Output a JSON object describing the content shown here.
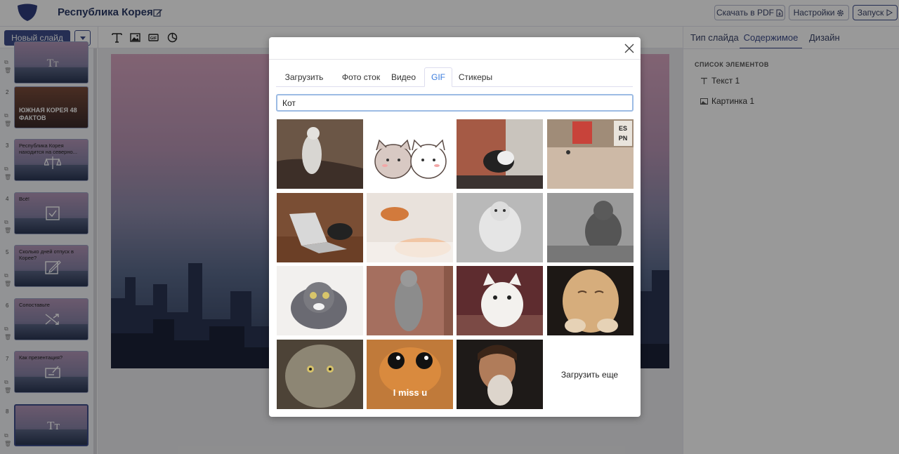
{
  "app": {
    "presentation_title": "Республика Корея",
    "download_label": "Скачать в PDF",
    "settings_label": "Настройки",
    "launch_label": "Запуск"
  },
  "toolbar": {
    "new_slide_label": "Новый слайд"
  },
  "slides": [
    {
      "number": "",
      "text": ""
    },
    {
      "number": "2",
      "text": "ЮЖНАЯ КОРЕЯ 48 ФАКТОВ"
    },
    {
      "number": "3",
      "text": "Республика Корея находится на северно..."
    },
    {
      "number": "4",
      "text": "Всё!"
    },
    {
      "number": "5",
      "text": "Сколько дней отпуск в Корее?"
    },
    {
      "number": "6",
      "text": "Сопоставьте"
    },
    {
      "number": "7",
      "text": "Как презентация?"
    },
    {
      "number": "8",
      "text": ""
    }
  ],
  "right_panel": {
    "tabs": [
      "Тип слайда",
      "Содержимое",
      "Дизайн"
    ],
    "active_tab": "Содержимое",
    "list_heading": "СПИСОК ЭЛЕМЕНТОВ",
    "items": [
      {
        "label": "Текст 1",
        "icon": "text-icon"
      },
      {
        "label": "Картинка 1",
        "icon": "image-icon"
      }
    ]
  },
  "modal": {
    "tabs": [
      "Загрузить",
      "Фото сток",
      "Видео",
      "GIF",
      "Стикеры"
    ],
    "active_tab": "GIF",
    "search_value": "Кот",
    "load_more_label": "Загрузить еще",
    "gif_captions": {
      "miss_u": "I miss u"
    },
    "gif_count": 15
  },
  "colors": {
    "brand": "#3f4d8a",
    "active_tab": "#3b7ddd"
  }
}
